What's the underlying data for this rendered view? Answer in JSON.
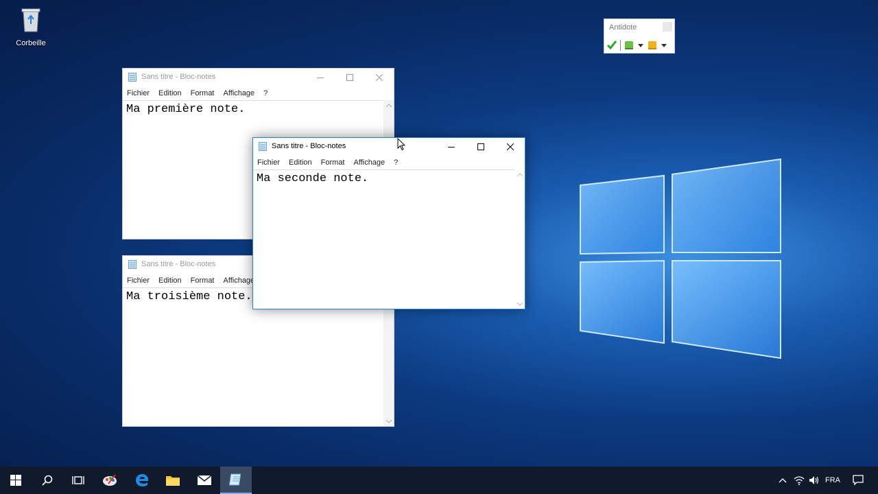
{
  "desktop": {
    "recycle_bin_label": "Corbeille"
  },
  "antidote": {
    "title": "Antidote"
  },
  "windows": [
    {
      "title": "Sans titre - Bloc-notes",
      "menu": [
        "Fichier",
        "Edition",
        "Format",
        "Affichage",
        "?"
      ],
      "text": "Ma première note."
    },
    {
      "title": "Sans titre - Bloc-notes",
      "menu": [
        "Fichier",
        "Edition",
        "Format",
        "Affichage",
        "?"
      ],
      "text": "Ma seconde note."
    },
    {
      "title": "Sans titre - Bloc-notes",
      "menu": [
        "Fichier",
        "Edition",
        "Format",
        "Affichage",
        "?"
      ],
      "text": "Ma troisième note."
    }
  ],
  "taskbar": {
    "items": [
      "start-icon",
      "search-icon",
      "task-view-icon",
      "paint-icon",
      "edge-icon",
      "file-explorer-icon",
      "mail-icon",
      "notepad-icon"
    ],
    "language": "FRA"
  },
  "colors": {
    "accent": "#2d7dd2",
    "taskbar": "#101a2a",
    "desktop_blue": "#0c3a80"
  }
}
